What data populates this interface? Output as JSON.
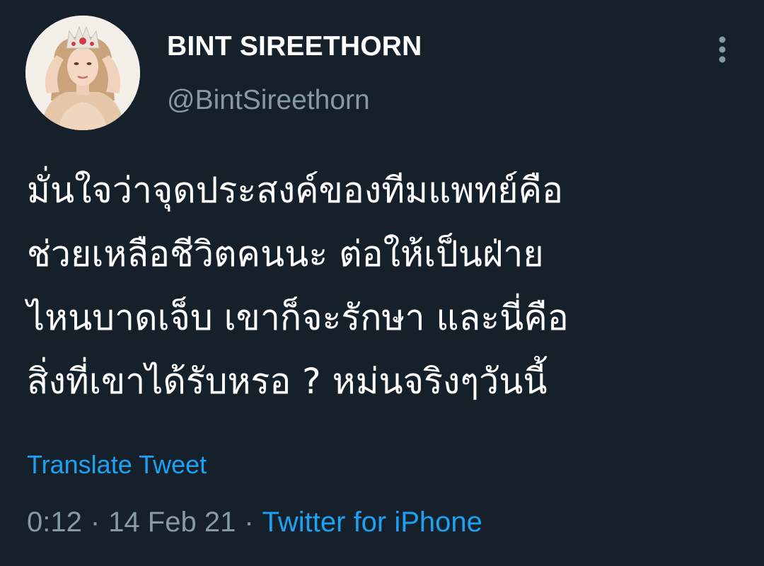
{
  "user": {
    "display_name": "BINT SIREETHORN",
    "handle": "@BintSireethorn"
  },
  "tweet": {
    "lines": [
      "มั่นใจว่าจุดประสงค์ของทีมแพทย์คือ",
      "ช่วยเหลือชีวิตคนนะ ต่อให้เป็นฝ่าย",
      "ไหนบาดเจ็บ เขาก็จะรักษา และนี่คือ",
      "สิ่งที่เขาได้รับหรอ ? หม่นจริงๆวันนี้"
    ],
    "translate_label": "Translate Tweet",
    "time": "0:12",
    "date": "14 Feb 21",
    "separator": "·",
    "source": "Twitter for iPhone"
  },
  "icons": {
    "more": "more-vertical-icon",
    "avatar": "avatar"
  },
  "colors": {
    "background": "#15202b",
    "text": "#ffffff",
    "muted": "#8899a6",
    "accent": "#1da1f2"
  }
}
